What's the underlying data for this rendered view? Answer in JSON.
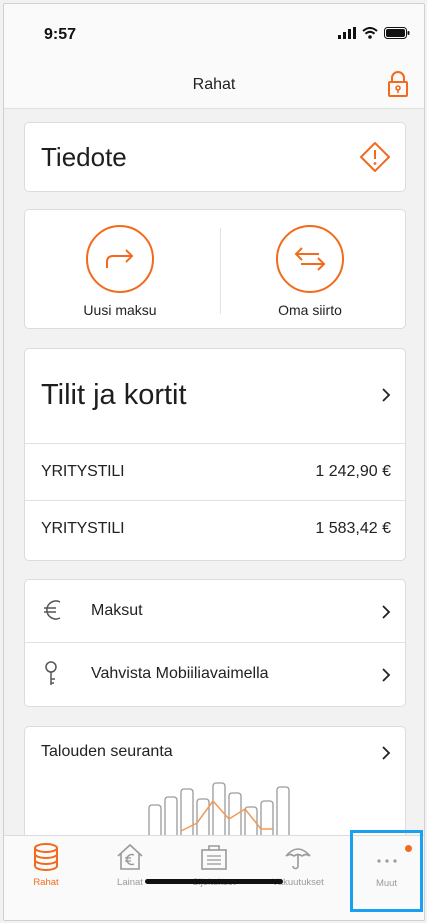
{
  "status": {
    "time": "9:57"
  },
  "nav": {
    "title": "Rahat"
  },
  "notice": {
    "label": "Tiedote"
  },
  "actions": [
    {
      "label": "Uusi maksu"
    },
    {
      "label": "Oma siirto"
    }
  ],
  "accounts": {
    "title": "Tilit ja kortit",
    "items": [
      {
        "name": "YRITYSTILI",
        "amount": "1 242,90 €"
      },
      {
        "name": "YRITYSTILI",
        "amount": "1 583,42 €"
      }
    ]
  },
  "links": [
    {
      "label": "Maksut",
      "icon": "euro-icon"
    },
    {
      "label": "Vahvista Mobiiliavaimella",
      "icon": "key-icon"
    }
  ],
  "finance": {
    "title": "Talouden seuranta"
  },
  "tabs": [
    {
      "label": "Rahat",
      "icon": "coins-icon",
      "active": true
    },
    {
      "label": "Lainat",
      "icon": "house-euro-icon",
      "active": false
    },
    {
      "label": "Sijoitukset",
      "icon": "briefcase-icon",
      "active": false
    },
    {
      "label": "Vakuutukset",
      "icon": "umbrella-icon",
      "active": false
    },
    {
      "label": "Muut",
      "icon": "more-icon",
      "active": false
    }
  ],
  "colors": {
    "accent": "#f26b1d",
    "highlight": "#1aa0f0",
    "inactive": "#9a9a9a"
  }
}
